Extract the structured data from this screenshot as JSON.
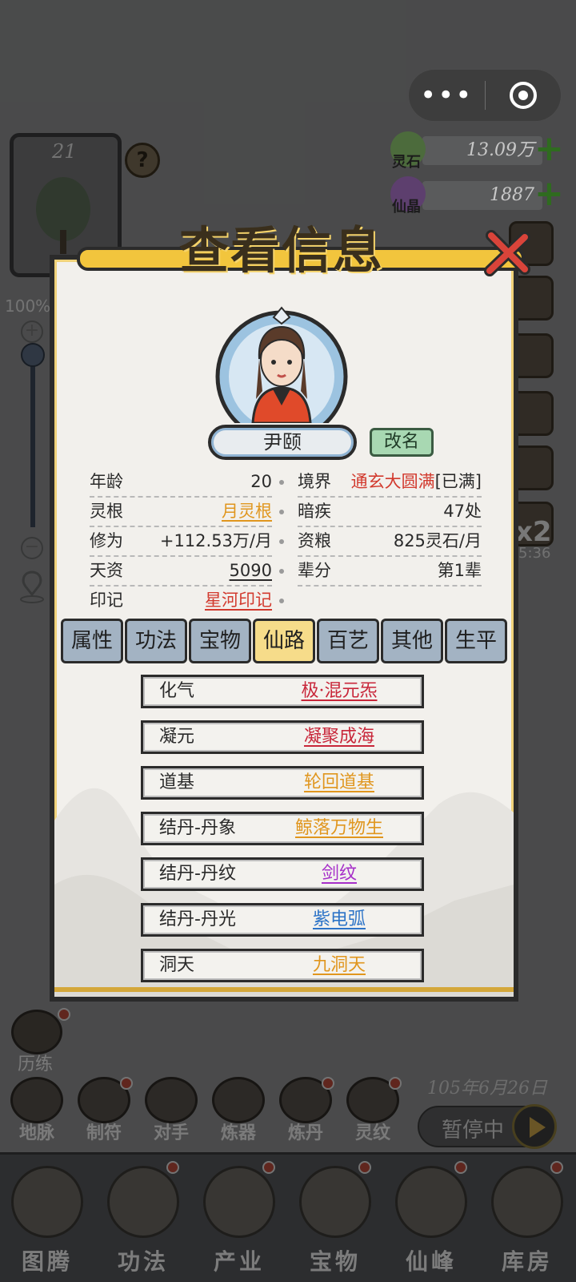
{
  "hud": {
    "level": "21",
    "help_glyph": "?",
    "zoom": "100%",
    "zoom_in_glyph": "+",
    "zoom_out_glyph": "−",
    "speed": "x2",
    "speed_timer": "5:36",
    "trial_label": "历练",
    "game_date": "105年6月26日",
    "pause_label": "暂停中"
  },
  "capsule": {
    "more_glyph": "•••"
  },
  "resources": [
    {
      "name": "灵石",
      "value": "13.09万",
      "icon": "spirit-stone-icon",
      "color": "#6a9a4a"
    },
    {
      "name": "仙晶",
      "value": "1887",
      "icon": "immortal-crystal-icon",
      "color": "#8a4ab0"
    }
  ],
  "side_buttons": [
    {
      "label": "地脉",
      "icon": "earth-vein-icon"
    },
    {
      "label": "制符",
      "icon": "talisman-icon"
    },
    {
      "label": "对手",
      "icon": "opponent-icon"
    },
    {
      "label": "炼器",
      "icon": "forge-icon"
    },
    {
      "label": "炼丹",
      "icon": "alchemy-icon"
    },
    {
      "label": "灵纹",
      "icon": "spirit-pattern-icon"
    }
  ],
  "bottom_nav": [
    {
      "label": "图腾",
      "icon": "totem-icon"
    },
    {
      "label": "功法",
      "icon": "technique-icon"
    },
    {
      "label": "产业",
      "icon": "industry-icon"
    },
    {
      "label": "宝物",
      "icon": "treasure-icon"
    },
    {
      "label": "仙峰",
      "icon": "peak-icon"
    },
    {
      "label": "库房",
      "icon": "storehouse-icon"
    }
  ],
  "modal": {
    "title": "查看信息",
    "character_name": "尹颐",
    "rename_label": "改名",
    "info_left": [
      {
        "key": "年龄",
        "value": "20"
      },
      {
        "key": "灵根",
        "value": "月灵根"
      },
      {
        "key": "修为",
        "value": "+112.53万/月"
      },
      {
        "key": "天资",
        "value": "5090"
      },
      {
        "key": "印记",
        "value": "星河印记"
      }
    ],
    "info_right": [
      {
        "key": "境界",
        "value": "通玄大圆满",
        "suffix": "[已满]"
      },
      {
        "key": "暗疾",
        "value": "47处"
      },
      {
        "key": "资粮",
        "value": "825灵石/月"
      },
      {
        "key": "辈分",
        "value": "第1辈"
      }
    ],
    "tabs": [
      "属性",
      "功法",
      "宝物",
      "仙路",
      "百艺",
      "其他",
      "生平"
    ],
    "active_tab": "仙路",
    "path": [
      {
        "key": "化气",
        "value": "极·混元炁",
        "color": "#c8273a"
      },
      {
        "key": "凝元",
        "value": "凝聚成海",
        "color": "#c8273a"
      },
      {
        "key": "道基",
        "value": "轮回道基",
        "color": "#e0961e"
      },
      {
        "key": "结丹-丹象",
        "value": "鲸落万物生",
        "color": "#e0961e"
      },
      {
        "key": "结丹-丹纹",
        "value": "剑纹",
        "color": "#a62fc9"
      },
      {
        "key": "结丹-丹光",
        "value": "紫电弧",
        "color": "#2d74c7"
      },
      {
        "key": "洞天",
        "value": "九洞天",
        "color": "#e0961e"
      }
    ]
  }
}
